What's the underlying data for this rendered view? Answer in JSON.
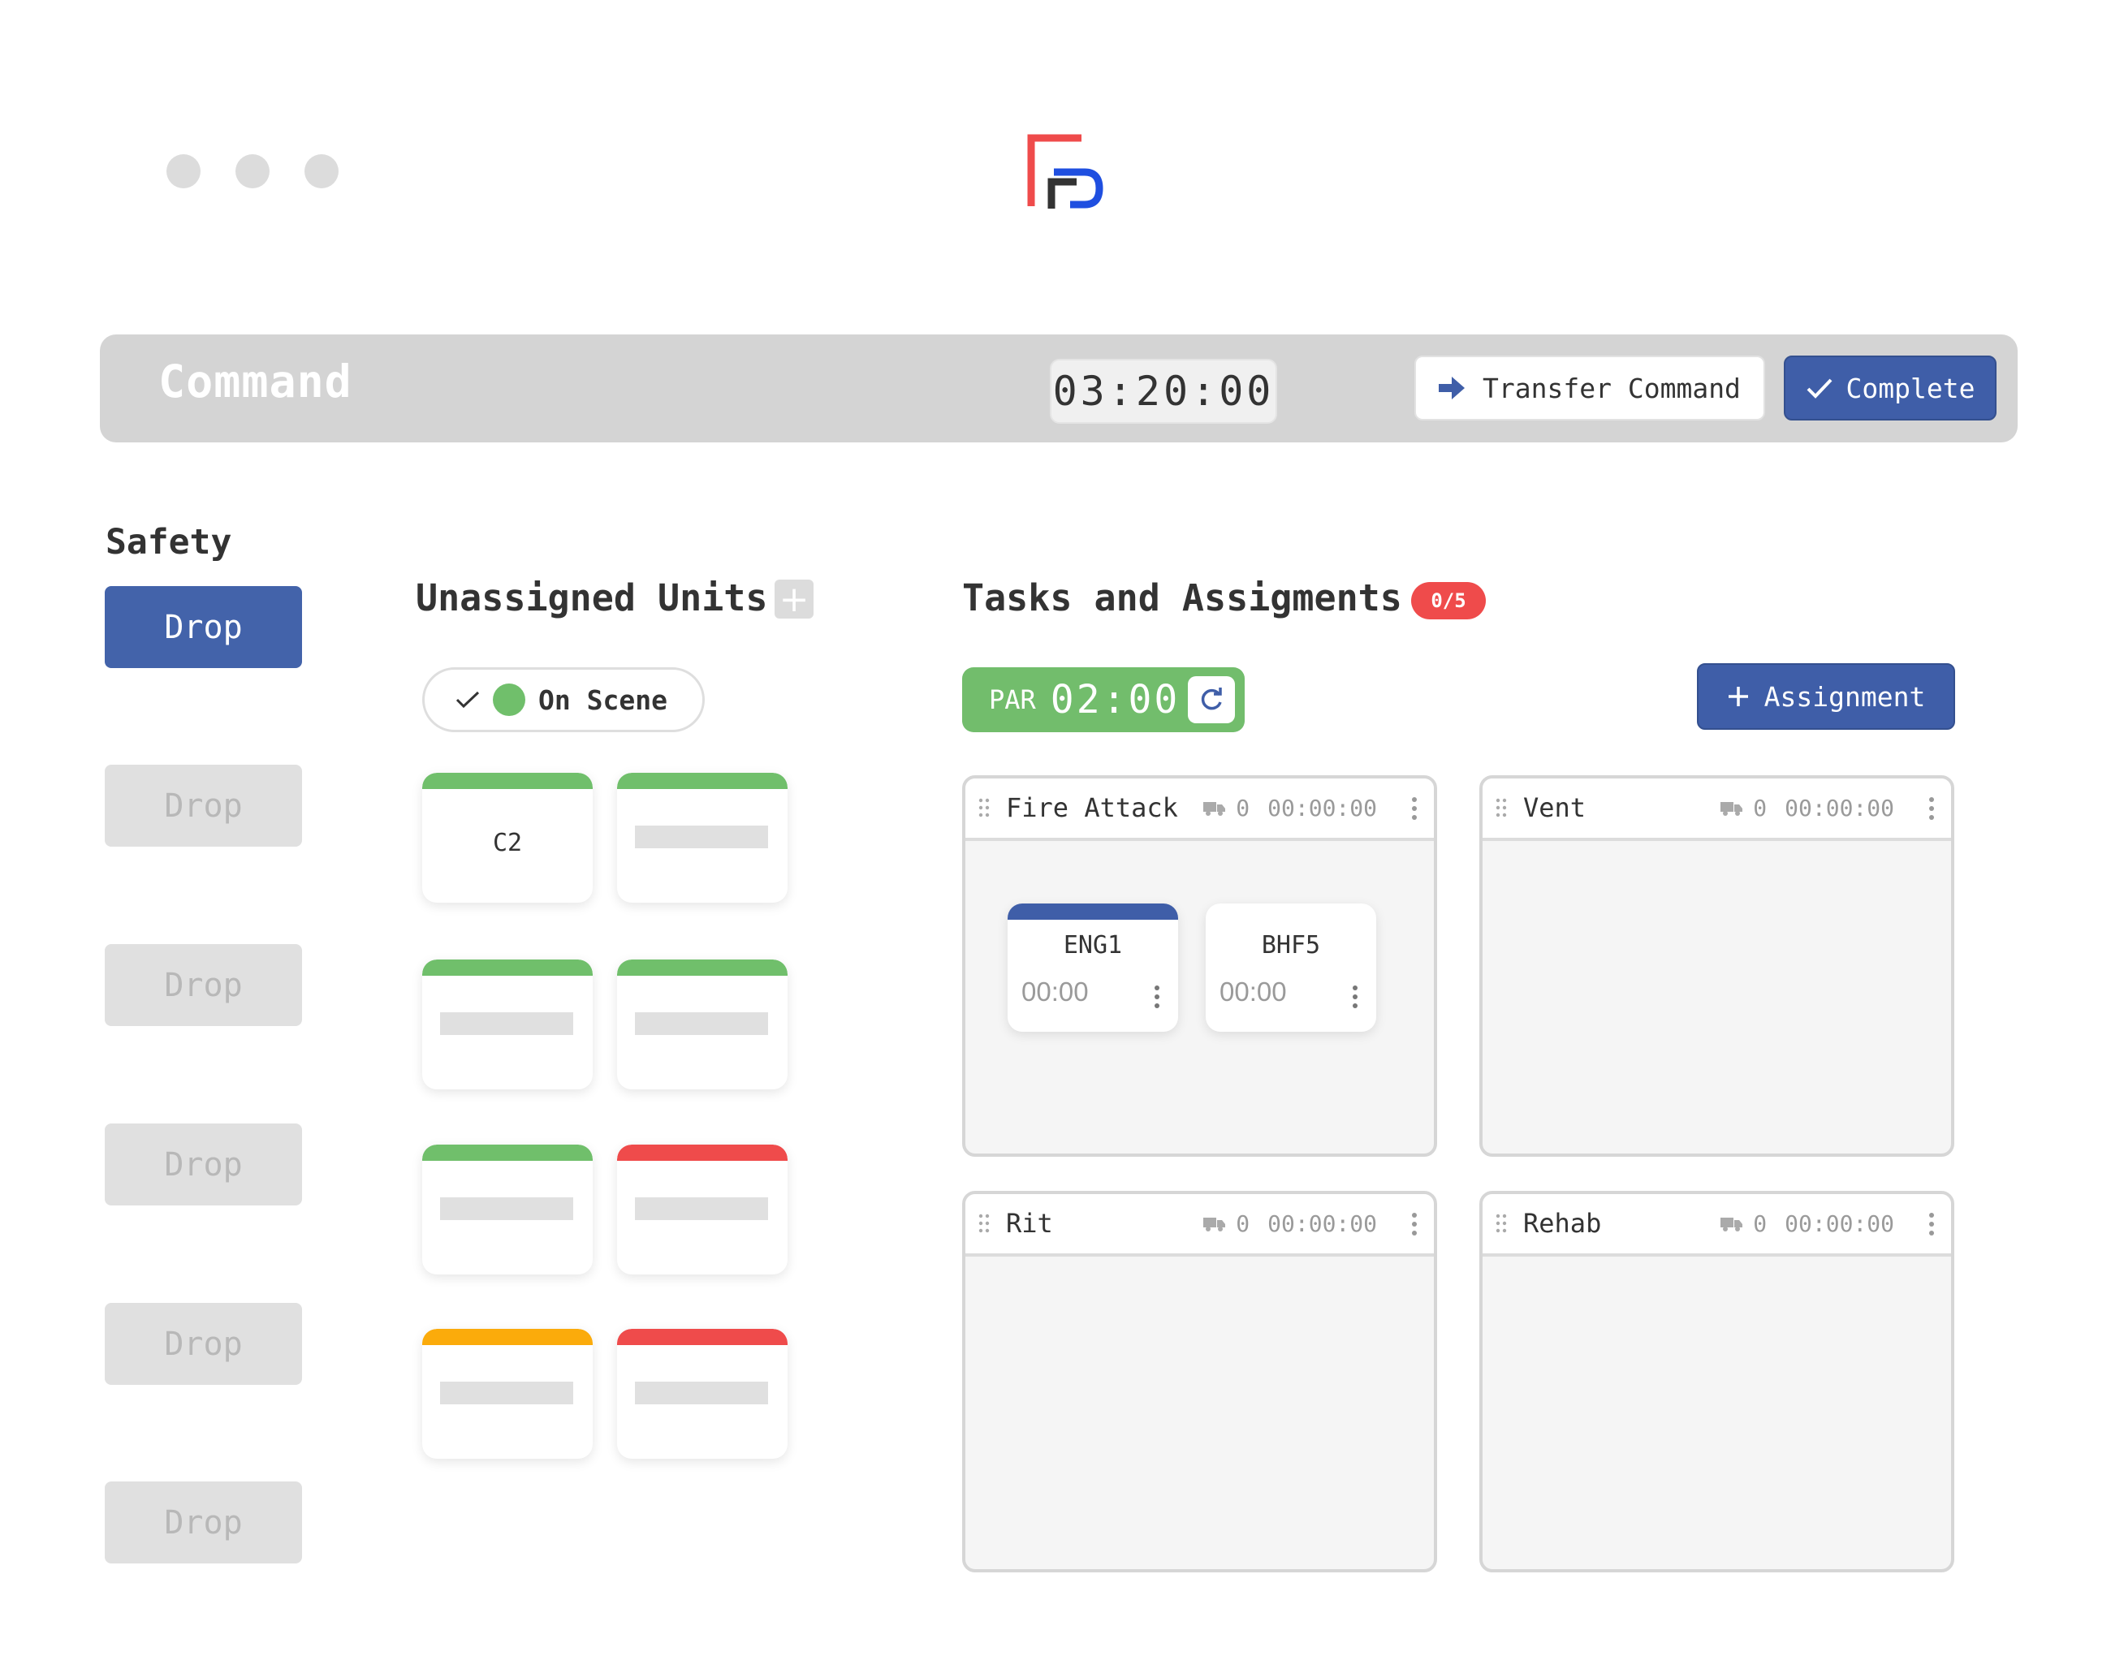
{
  "logo": {
    "colors": {
      "red": "#ef4b4b",
      "blue": "#1f4fe0",
      "dark": "#333333"
    }
  },
  "header": {
    "title": "Command",
    "timer": "03:20:00",
    "transfer_label": "Transfer Command",
    "complete_label": "Complete"
  },
  "safety": {
    "title": "Safety",
    "drops": [
      "Drop",
      "Drop",
      "Drop",
      "Drop",
      "Drop",
      "Drop"
    ]
  },
  "unassigned": {
    "title": "Unassigned Units",
    "add_symbol": "+",
    "filter_label": "On Scene",
    "units": [
      {
        "label": "C2",
        "status_color": "#70bf6b"
      },
      {
        "label": "",
        "status_color": "#70bf6b"
      },
      {
        "label": "",
        "status_color": "#70bf6b"
      },
      {
        "label": "",
        "status_color": "#70bf6b"
      },
      {
        "label": "",
        "status_color": "#70bf6b"
      },
      {
        "label": "",
        "status_color": "#ef4b4b"
      },
      {
        "label": "",
        "status_color": "#fbab0b"
      },
      {
        "label": "",
        "status_color": "#ef4b4b"
      }
    ]
  },
  "tasks": {
    "title": "Tasks and Assigments",
    "badge": "0/5",
    "par_label": "PAR",
    "par_time": "02:00",
    "add_assignment_label": "Assignment",
    "panels": [
      {
        "name": "Fire Attack",
        "count": "0",
        "timer": "00:00:00",
        "units": [
          {
            "name": "ENG1",
            "time": "00:00"
          },
          {
            "name": "BHF5",
            "time": "00:00"
          }
        ]
      },
      {
        "name": "Vent",
        "count": "0",
        "timer": "00:00:00",
        "units": []
      },
      {
        "name": "Rit",
        "count": "0",
        "timer": "00:00:00",
        "units": []
      },
      {
        "name": "Rehab",
        "count": "0",
        "timer": "00:00:00",
        "units": []
      }
    ]
  },
  "colors": {
    "accent": "#3f5ea8",
    "green": "#72bd6c",
    "red": "#ef4b4b",
    "orange": "#fbab0b",
    "grey_bar": "#d4d4d4"
  }
}
